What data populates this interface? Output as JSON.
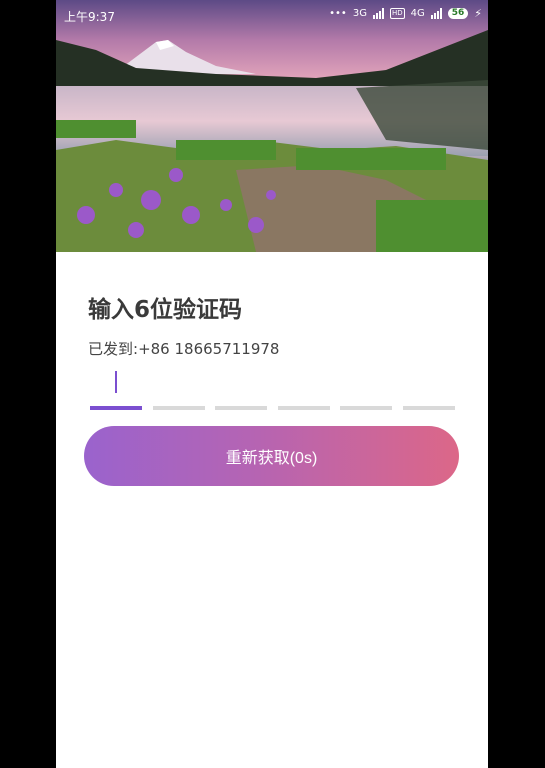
{
  "status_bar": {
    "time": "上午9:37",
    "dots": "•••",
    "net1": "3G",
    "hd": "HD",
    "net2": "4G",
    "battery": "56",
    "bolt": "⚡"
  },
  "verify": {
    "title": "输入6位验证码",
    "sent_prefix": "已发到:",
    "phone_number": "+86 18665711978",
    "code_length": 6,
    "active_index": 0,
    "resend_label": "重新获取(0s)"
  },
  "colors": {
    "accent": "#7b4fd0",
    "gradient_start": "#9a63cd",
    "gradient_end": "#dc6788"
  }
}
